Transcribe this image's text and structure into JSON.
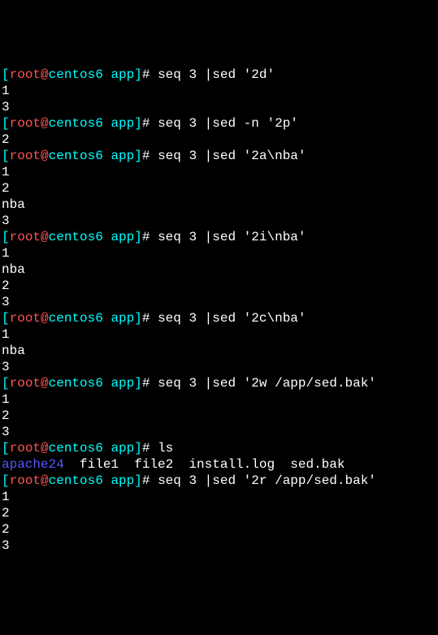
{
  "prompt": {
    "br_open": "[",
    "user": "root",
    "at": "@",
    "host": "centos6",
    "path": " app",
    "br_close": "]",
    "hash": "# "
  },
  "lines": [
    {
      "type": "cmd",
      "text": "seq 3 |sed '2d'"
    },
    {
      "type": "out",
      "text": "1"
    },
    {
      "type": "out",
      "text": "3"
    },
    {
      "type": "cmd",
      "text": "seq 3 |sed -n '2p'"
    },
    {
      "type": "out",
      "text": "2"
    },
    {
      "type": "cmd",
      "text": "seq 3 |sed '2a\\nba'"
    },
    {
      "type": "out",
      "text": "1"
    },
    {
      "type": "out",
      "text": "2"
    },
    {
      "type": "out",
      "text": "nba"
    },
    {
      "type": "out",
      "text": "3"
    },
    {
      "type": "cmd",
      "text": "seq 3 |sed '2i\\nba'"
    },
    {
      "type": "out",
      "text": "1"
    },
    {
      "type": "out",
      "text": "nba"
    },
    {
      "type": "out",
      "text": "2"
    },
    {
      "type": "out",
      "text": "3"
    },
    {
      "type": "cmd",
      "text": "seq 3 |sed '2c\\nba'"
    },
    {
      "type": "out",
      "text": "1"
    },
    {
      "type": "out",
      "text": "nba"
    },
    {
      "type": "out",
      "text": "3"
    },
    {
      "type": "cmd",
      "text": "seq 3 |sed '2w /app/sed.bak'"
    },
    {
      "type": "out",
      "text": "1"
    },
    {
      "type": "out",
      "text": "2"
    },
    {
      "type": "out",
      "text": "3"
    },
    {
      "type": "cmd",
      "text": "ls"
    },
    {
      "type": "ls",
      "dir": "apache24",
      "rest": "  file1  file2  install.log  sed.bak"
    },
    {
      "type": "cmd",
      "text": "seq 3 |sed '2r /app/sed.bak'"
    },
    {
      "type": "out",
      "text": "1"
    },
    {
      "type": "out",
      "text": "2"
    },
    {
      "type": "out",
      "text": "2"
    },
    {
      "type": "out",
      "text": "3"
    }
  ]
}
